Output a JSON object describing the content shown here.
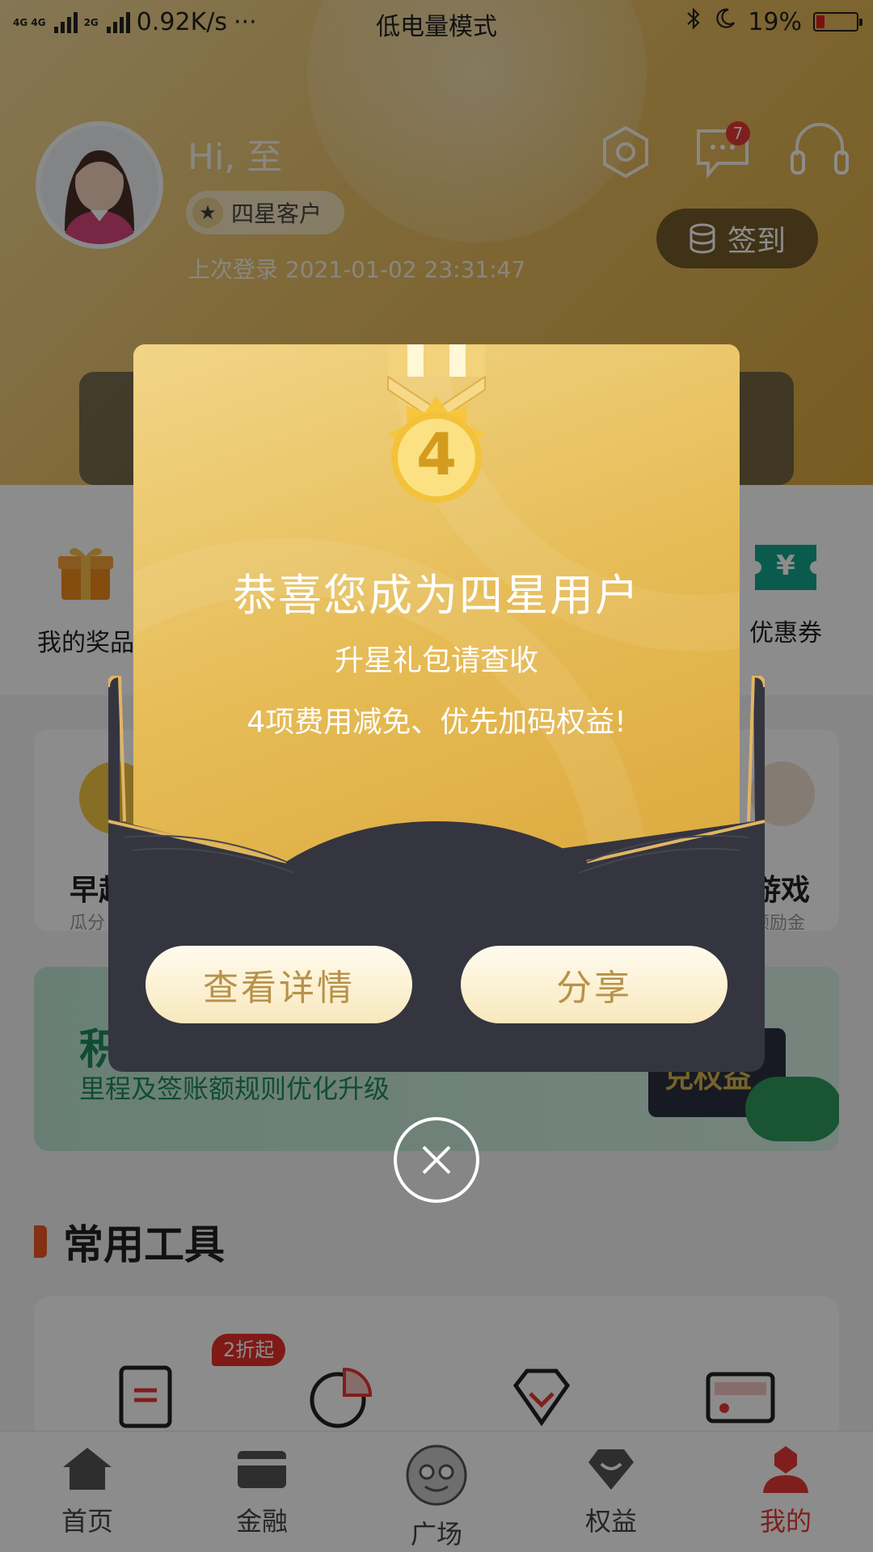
{
  "status_bar": {
    "network_1": "4G 4G",
    "network_2": "2G",
    "speed": "0.92K/s",
    "dots": "···",
    "mode": "低电量模式",
    "battery": "19%",
    "battery_level": 0.19
  },
  "profile": {
    "greeting": "Hi, 至",
    "level_label": "四星客户",
    "last_login": "上次登录 2021-01-02 23:31:47",
    "message_badge": "7",
    "checkin_label": "签到"
  },
  "quick": {
    "prize_label": "我的奖品",
    "coupon_label": "优惠券",
    "coupon_symbol": "¥"
  },
  "cards": {
    "left_title": "早起",
    "left_sub": "瓜分",
    "right_title": "游戏",
    "right_sub": "领励金"
  },
  "banner": {
    "title": "积",
    "subtitle": "里程及签账额规则优化升级",
    "art_text": "兑权益"
  },
  "tools": {
    "section_title": "常用工具",
    "badge": "2折起"
  },
  "tabs": [
    {
      "label": "首页",
      "icon": "home-icon"
    },
    {
      "label": "金融",
      "icon": "card-icon"
    },
    {
      "label": "广场",
      "icon": "mascot-icon"
    },
    {
      "label": "权益",
      "icon": "diamond-icon"
    },
    {
      "label": "我的",
      "icon": "user-icon"
    }
  ],
  "modal": {
    "medal_number": "4",
    "title": "恭喜您成为四星用户",
    "subtitle_1": "升星礼包请查收",
    "subtitle_2": "4项费用减免、优先加码权益!",
    "details_button": "查看详情",
    "share_button": "分享"
  },
  "colors": {
    "gold": "#e6bb55",
    "envelope": "#34353f",
    "button_text": "#b8924a",
    "active_tab": "#e53935"
  }
}
